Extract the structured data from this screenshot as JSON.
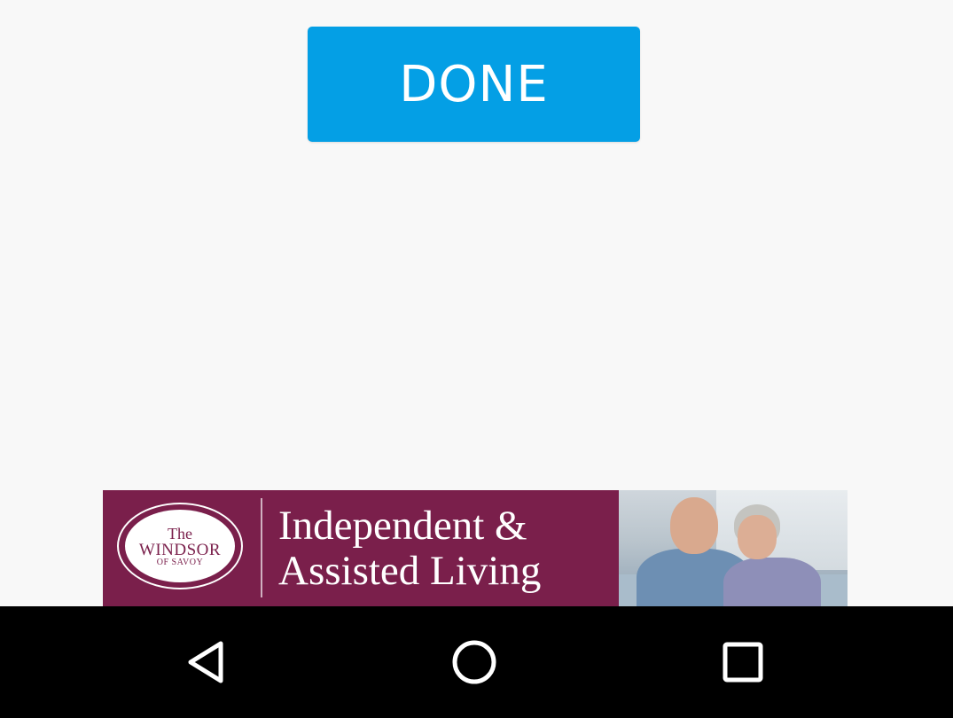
{
  "done_button": {
    "label": "DONE",
    "color": "#049fe5"
  },
  "ad_banner": {
    "logo": {
      "line1": "The",
      "line2": "WINDSOR",
      "line3": "OF SAVOY"
    },
    "headline_line1": "Independent &",
    "headline_line2": "Assisted Living",
    "background_color": "#7a1f4b",
    "image": "senior-couple-photo"
  },
  "nav_bar": {
    "buttons": [
      {
        "name": "back",
        "icon": "back-triangle-icon"
      },
      {
        "name": "home",
        "icon": "home-circle-icon"
      },
      {
        "name": "recents",
        "icon": "recents-square-icon"
      }
    ]
  }
}
